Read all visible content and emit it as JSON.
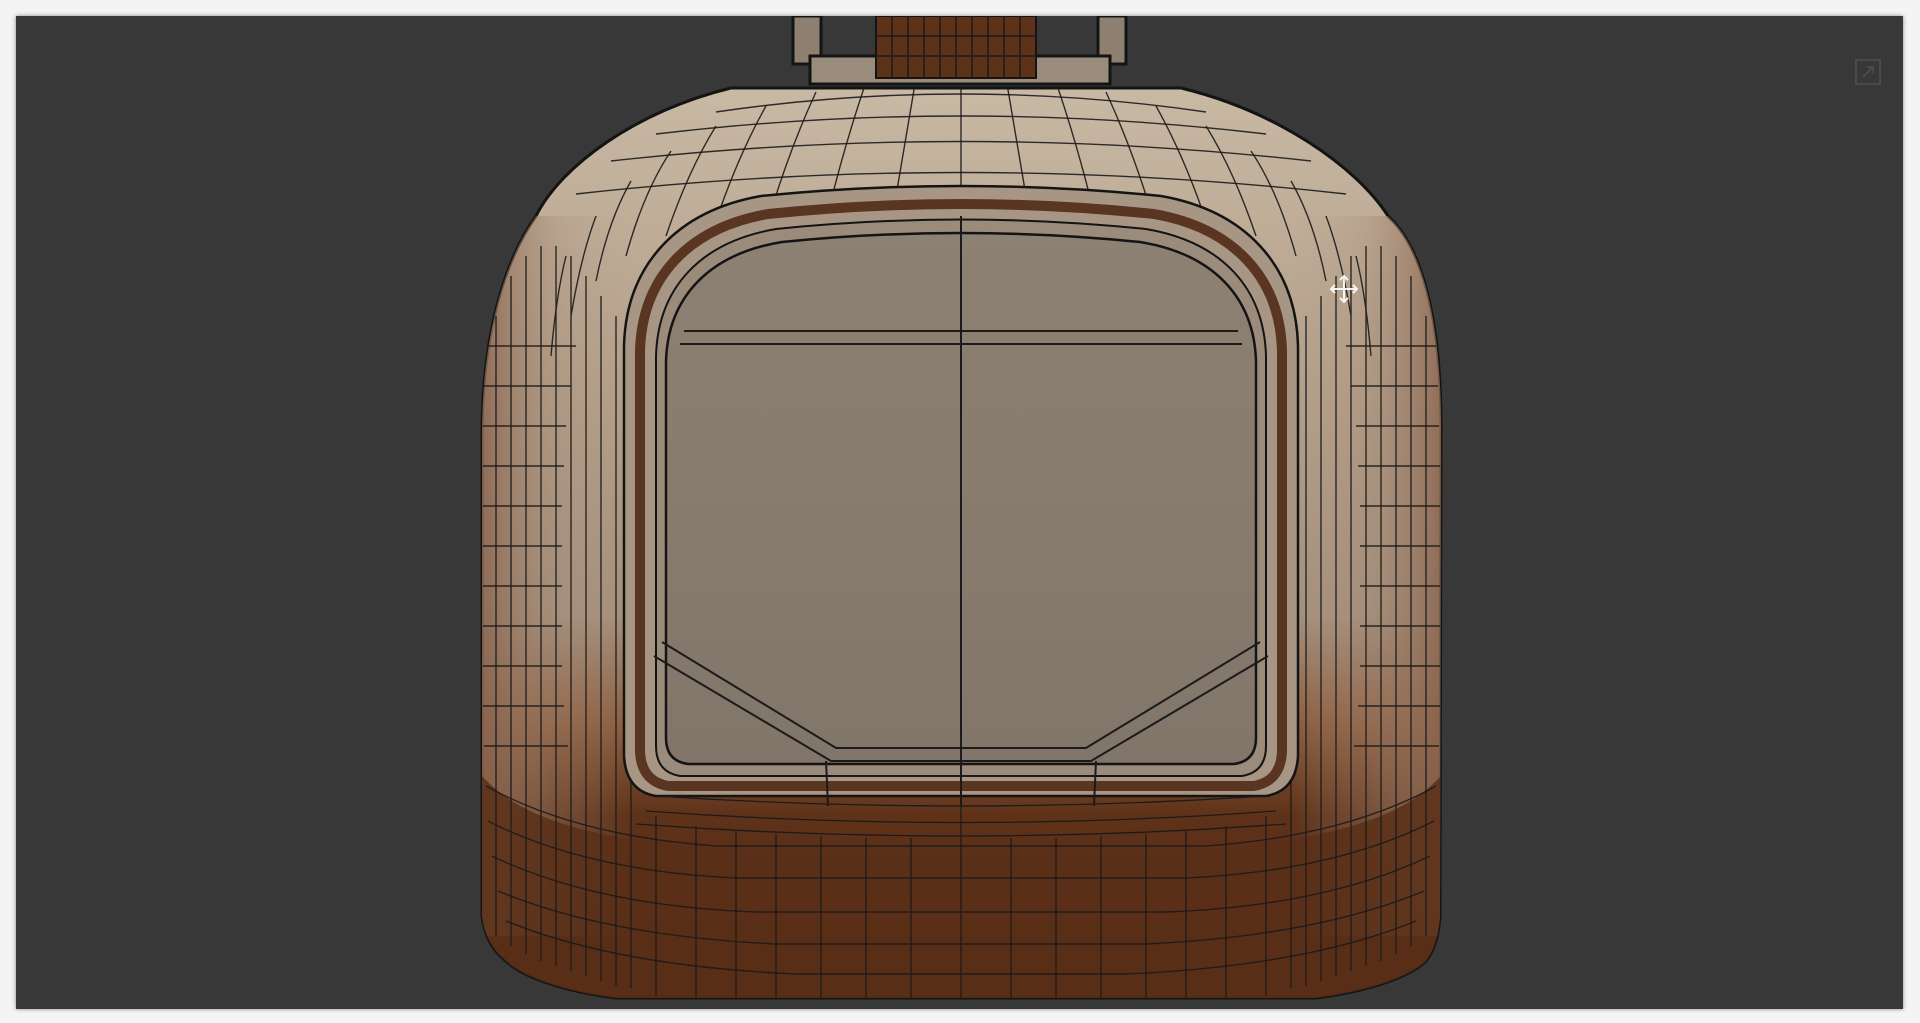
{
  "viewport": {
    "background_color": "#383838",
    "mesh_colors": {
      "outline": "#141414",
      "wire": "#1b1b1b",
      "top_rim_light": "#c6b7a2",
      "top_rim_mid": "#a18d78",
      "side_shade": "#9a7e68",
      "side_dark": "#866550",
      "inner_face": "#85796b",
      "inner_band": "#93877a",
      "groove": "#5a3522",
      "bottom_brown": "#5f3419",
      "bottom_deep": "#4a2712"
    }
  },
  "controls": {
    "maximize_icon": "maximize-icon",
    "cursor_icon": "move-cursor-icon"
  }
}
